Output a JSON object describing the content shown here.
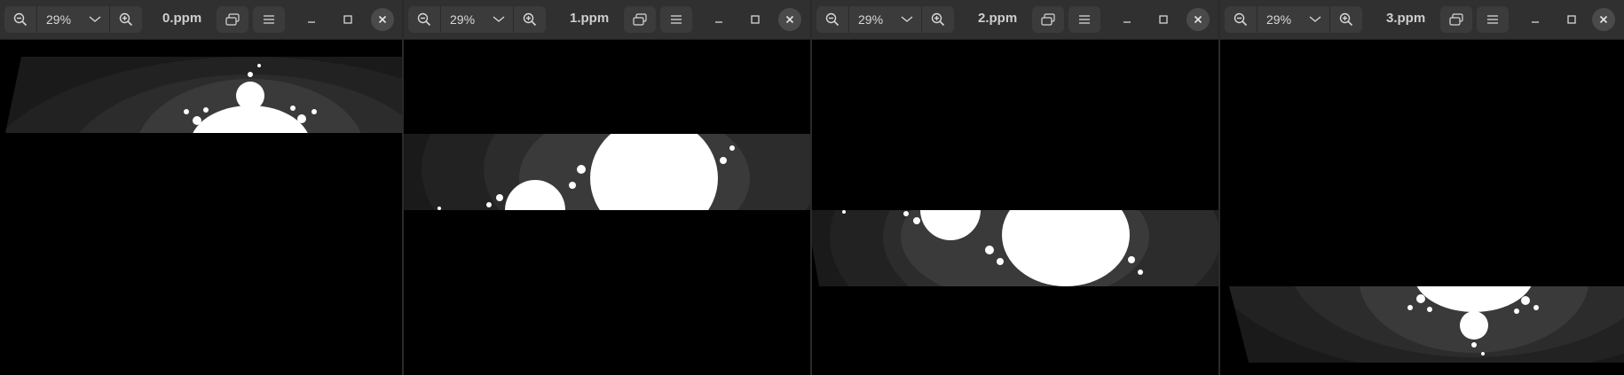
{
  "windows": [
    {
      "title": "0.ppm",
      "zoom": "29%",
      "image_position": "top"
    },
    {
      "title": "1.ppm",
      "zoom": "29%",
      "image_position": "upper-middle"
    },
    {
      "title": "2.ppm",
      "zoom": "29%",
      "image_position": "lower-middle"
    },
    {
      "title": "3.ppm",
      "zoom": "29%",
      "image_position": "bottom"
    }
  ],
  "icons": {
    "zoom_out": "zoom-out-icon",
    "zoom_in": "zoom-in-icon",
    "zoom_menu": "chevron-down-icon",
    "view_toggle": "view-toggle-icon",
    "menu": "hamburger-menu-icon",
    "minimize": "minimize-icon",
    "maximize": "maximize-icon",
    "close": "close-icon"
  },
  "colors": {
    "headerbar": "#303030",
    "button": "#3b3b3b",
    "background": "#000000",
    "fractal": "#ffffff"
  }
}
